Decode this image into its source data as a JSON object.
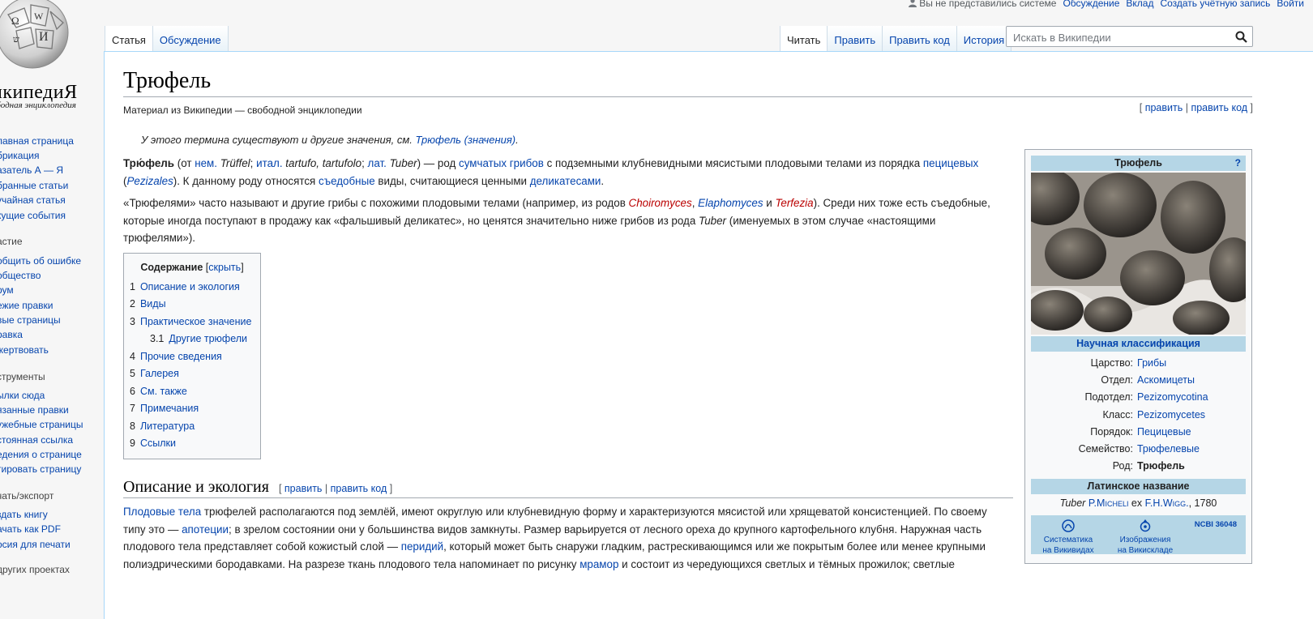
{
  "logo": {
    "wordmark": "Википедия",
    "wordmark_display": "икипедиЯ",
    "tagline": "ободная энциклопедия"
  },
  "personal": {
    "not_logged": "Вы не представились системе",
    "talk": "Обсуждение",
    "contributions": "Вклад",
    "create_account": "Создать учётную запись",
    "login": "Войти"
  },
  "tabs": {
    "left": [
      {
        "label": "Статья"
      },
      {
        "label": "Обсуждение"
      }
    ],
    "right": [
      {
        "label": "Читать"
      },
      {
        "label": "Править"
      },
      {
        "label": "Править код"
      },
      {
        "label": "История"
      }
    ]
  },
  "search": {
    "placeholder": "Искать в Википедии",
    "icon": "search-icon"
  },
  "sidebar": {
    "nav": [
      "лавная страница",
      "брикация",
      "азатель А — Я",
      "бранные статьи",
      "учайная статья",
      "кущие события"
    ],
    "participation_heading": "астие",
    "participation": [
      "общить об ошибке",
      "общество",
      "рум",
      "ежие правки",
      "вые страницы",
      "равка",
      "жертвовать"
    ],
    "tools_heading": "струменты",
    "tools": [
      "ылки сюда",
      "язанные правки",
      "ужебные страницы",
      "стоянная ссылка",
      "едения о странице",
      "тировать страницу"
    ],
    "print_heading": "чать/экспорт",
    "print": [
      "здать книгу",
      "ачать как PDF",
      "осия для печати"
    ],
    "projects_heading": "других проектах"
  },
  "article": {
    "title": "Трюфель",
    "sitesub": "Материал из Википедии — свободной энциклопедии",
    "top_edit": {
      "open": "[ ",
      "edit": "править",
      "sep": " | ",
      "edit_code": "править код",
      "close": " ]"
    },
    "hatnote": {
      "text": "У этого термина существуют и другие значения, см. ",
      "link": "Трюфель (значения)",
      "end": "."
    },
    "p1": {
      "bold": "Трю́фель",
      "t1": " (от ",
      "de": "нем.",
      "de_word": " Trüffel",
      "t2": "; ",
      "it": "итал.",
      "it_word": " tartufo, tartufolo",
      "t3": "; ",
      "la": "лат.",
      "la_word": " Tuber",
      "t4": ") — род ",
      "marsup": "сумчатых грибов",
      "t5": " с подземными клубневидными мясистыми плодовыми телами из порядка ",
      "pez": "пецицевых",
      "t6": " (",
      "pez_lat": "Pezizales",
      "t7": "). К данному роду относятся ",
      "edible": "съедобные",
      "t8": " виды, считающиеся ценными ",
      "delic": "деликатесами",
      "t9": "."
    },
    "p2": {
      "t1": "«Трюфелями» часто называют и другие грибы с похожими плодовыми телами (например, из родов ",
      "g1": "Choiromyces",
      "t2": ", ",
      "g2": "Elaphomyces",
      "t3": " и ",
      "g3": "Terfezia",
      "t4": "). Среди них тоже есть съедобные, которые иногда поступают в продажу как «фальшивый деликатес», но ценятся значительно ниже грибов из рода ",
      "g4": "Tuber",
      "t5": " (именуемых в этом случае «настоящими трюфелями»)."
    },
    "toc": {
      "title": "Содержание",
      "hide_open": " [",
      "hide": "скрыть",
      "hide_close": "]",
      "items": [
        {
          "num": "1",
          "label": "Описание и экология"
        },
        {
          "num": "2",
          "label": "Виды"
        },
        {
          "num": "3",
          "label": "Практическое значение"
        },
        {
          "num": "3.1",
          "label": "Другие трюфели"
        },
        {
          "num": "4",
          "label": "Прочие сведения"
        },
        {
          "num": "5",
          "label": "Галерея"
        },
        {
          "num": "6",
          "label": "См. также"
        },
        {
          "num": "7",
          "label": "Примечания"
        },
        {
          "num": "8",
          "label": "Литература"
        },
        {
          "num": "9",
          "label": "Ссылки"
        }
      ]
    },
    "section": {
      "title": "Описание и экология",
      "edit_open": "[ ",
      "edit": "править",
      "sep": " | ",
      "edit_code": "править код",
      "edit_close": " ]"
    },
    "p3": {
      "l1": "Плодовые тела",
      "t1": " трюфелей располагаются под землёй, имеют округлую или клубневидную форму и характеризуются мясистой или хрящеватой консистенцией. По своему типу это — ",
      "l2": "апотеции",
      "t2": "; в зрелом состоянии они у большинства видов замкнуты. Размер варьируется от лесного ореха до крупного картофельного клубня. Наружная часть плодового тела представляет собой кожистый слой — ",
      "l3": "перидий",
      "t3": ", который может быть снаружи гладким, растрескивающимся или же покрытым более или менее крупными полиэдрическими бородавками. На разрезе ткань плодового тела напоминает по рисунку ",
      "l4": "мрамор",
      "t4": " и состоит из чередующихся светлых и тёмных прожилок; светлые"
    }
  },
  "infobox": {
    "title": "Трюфель",
    "help": "?",
    "classification_title": "Научная классификация",
    "rows": [
      {
        "key": "Царство:",
        "value": "Грибы",
        "bold": false
      },
      {
        "key": "Отдел:",
        "value": "Аскомицеты",
        "bold": false
      },
      {
        "key": "Подотдел:",
        "value": "Pezizomycotina",
        "bold": false
      },
      {
        "key": "Класс:",
        "value": "Pezizomycetes",
        "bold": false
      },
      {
        "key": "Порядок:",
        "value": "Пецицевые",
        "bold": false
      },
      {
        "key": "Семейство:",
        "value": "Трюфелевые",
        "bold": false
      },
      {
        "key": "Род:",
        "value": "Трюфель",
        "bold": true
      }
    ],
    "latin_title": "Латинское название",
    "author": {
      "genus": "Tuber",
      "a1": "P.Micheli",
      "ex": " ex ",
      "a2": "F.H.Wigg.",
      "year": ", 1780"
    },
    "links": [
      {
        "label1": "Систематика",
        "label2": "на Викивидах",
        "icon": "wikispecies-icon"
      },
      {
        "label1": "Изображения",
        "label2": "на Викискладе",
        "icon": "commons-icon"
      }
    ],
    "ncbi": "NCBI 36048"
  },
  "colors": {
    "link": "#0645ad",
    "red_link": "#ba0000",
    "infobox_band": "#b5d6e6",
    "border": "#a7d7f9"
  }
}
